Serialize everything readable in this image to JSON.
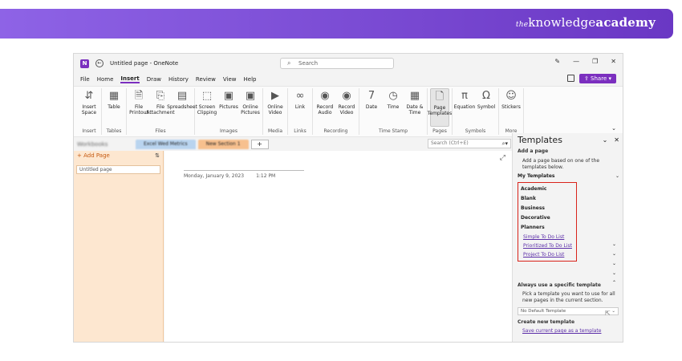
{
  "banner": {
    "brand_the": "the",
    "brand_knowledge": "knowledge",
    "brand_academy": "academy"
  },
  "titlebar": {
    "title": "Untitled page - OneNote",
    "search_placeholder": "Search"
  },
  "menu": {
    "items": [
      "File",
      "Home",
      "Insert",
      "Draw",
      "History",
      "Review",
      "View",
      "Help"
    ],
    "active": "Insert",
    "share": "Share"
  },
  "ribbon": {
    "groups": [
      {
        "label": "Insert",
        "buttons": [
          {
            "label": "Insert Space",
            "icon": "insert-space-icon",
            "glyph": "⇵"
          }
        ]
      },
      {
        "label": "Tables",
        "buttons": [
          {
            "label": "Table",
            "icon": "table-icon",
            "glyph": "▦"
          }
        ]
      },
      {
        "label": "Files",
        "buttons": [
          {
            "label": "File Printout",
            "icon": "file-printout-icon",
            "glyph": "🗎"
          },
          {
            "label": "File Attachment",
            "icon": "paperclip-icon",
            "glyph": "⎘"
          },
          {
            "label": "Spreadsheet",
            "icon": "spreadsheet-icon",
            "glyph": "▤"
          }
        ]
      },
      {
        "label": "Images",
        "buttons": [
          {
            "label": "Screen Clipping",
            "icon": "screen-clipping-icon",
            "glyph": "⬚"
          },
          {
            "label": "Pictures",
            "icon": "pictures-icon",
            "glyph": "▣"
          },
          {
            "label": "Online Pictures",
            "icon": "online-pictures-icon",
            "glyph": "▣"
          }
        ]
      },
      {
        "label": "Media",
        "buttons": [
          {
            "label": "Online Video",
            "icon": "online-video-icon",
            "glyph": "▶"
          }
        ]
      },
      {
        "label": "Links",
        "buttons": [
          {
            "label": "Link",
            "icon": "link-icon",
            "glyph": "∞"
          }
        ]
      },
      {
        "label": "Recording",
        "buttons": [
          {
            "label": "Record Audio",
            "icon": "record-audio-icon",
            "glyph": "◉"
          },
          {
            "label": "Record Video",
            "icon": "record-video-icon",
            "glyph": "◉"
          }
        ]
      },
      {
        "label": "Time Stamp",
        "buttons": [
          {
            "label": "Date",
            "icon": "calendar-icon",
            "glyph": "7"
          },
          {
            "label": "Time",
            "icon": "clock-icon",
            "glyph": "◷"
          },
          {
            "label": "Date & Time",
            "icon": "date-time-icon",
            "glyph": "▦"
          }
        ]
      },
      {
        "label": "Pages",
        "buttons": [
          {
            "label": "Page Templates",
            "icon": "page-templates-icon",
            "glyph": "🗋"
          }
        ]
      },
      {
        "label": "Symbols",
        "buttons": [
          {
            "label": "Equation",
            "icon": "equation-icon",
            "glyph": "π"
          },
          {
            "label": "Symbol",
            "icon": "omega-icon",
            "glyph": "Ω"
          }
        ]
      },
      {
        "label": "More",
        "buttons": [
          {
            "label": "Stickers",
            "icon": "sticker-icon",
            "glyph": "☺"
          }
        ]
      }
    ]
  },
  "sections": {
    "notebook": "Workbooks",
    "tabs": [
      "Excel Wed Metrics",
      "New Section 1"
    ],
    "search": "Search (Ctrl+E)"
  },
  "pages": {
    "add": "Add Page",
    "items": [
      "Untitled page"
    ]
  },
  "page": {
    "date": "Monday, January 9, 2023",
    "time": "1:12 PM"
  },
  "templates": {
    "title": "Templates",
    "add_heading": "Add a page",
    "add_desc": "Add a page based on one of the templates below.",
    "my": "My Templates",
    "categories": [
      "Academic",
      "Blank",
      "Business",
      "Decorative",
      "Planners"
    ],
    "planner_links": [
      "Simple To Do List",
      "Prioritized To Do List",
      "Project To Do List"
    ],
    "always_heading": "Always use a specific template",
    "always_desc": "Pick a template you want to use for all new pages in the current section.",
    "dropdown": "No Default Template",
    "create_heading": "Create new template",
    "save_link": "Save current page as a template"
  }
}
